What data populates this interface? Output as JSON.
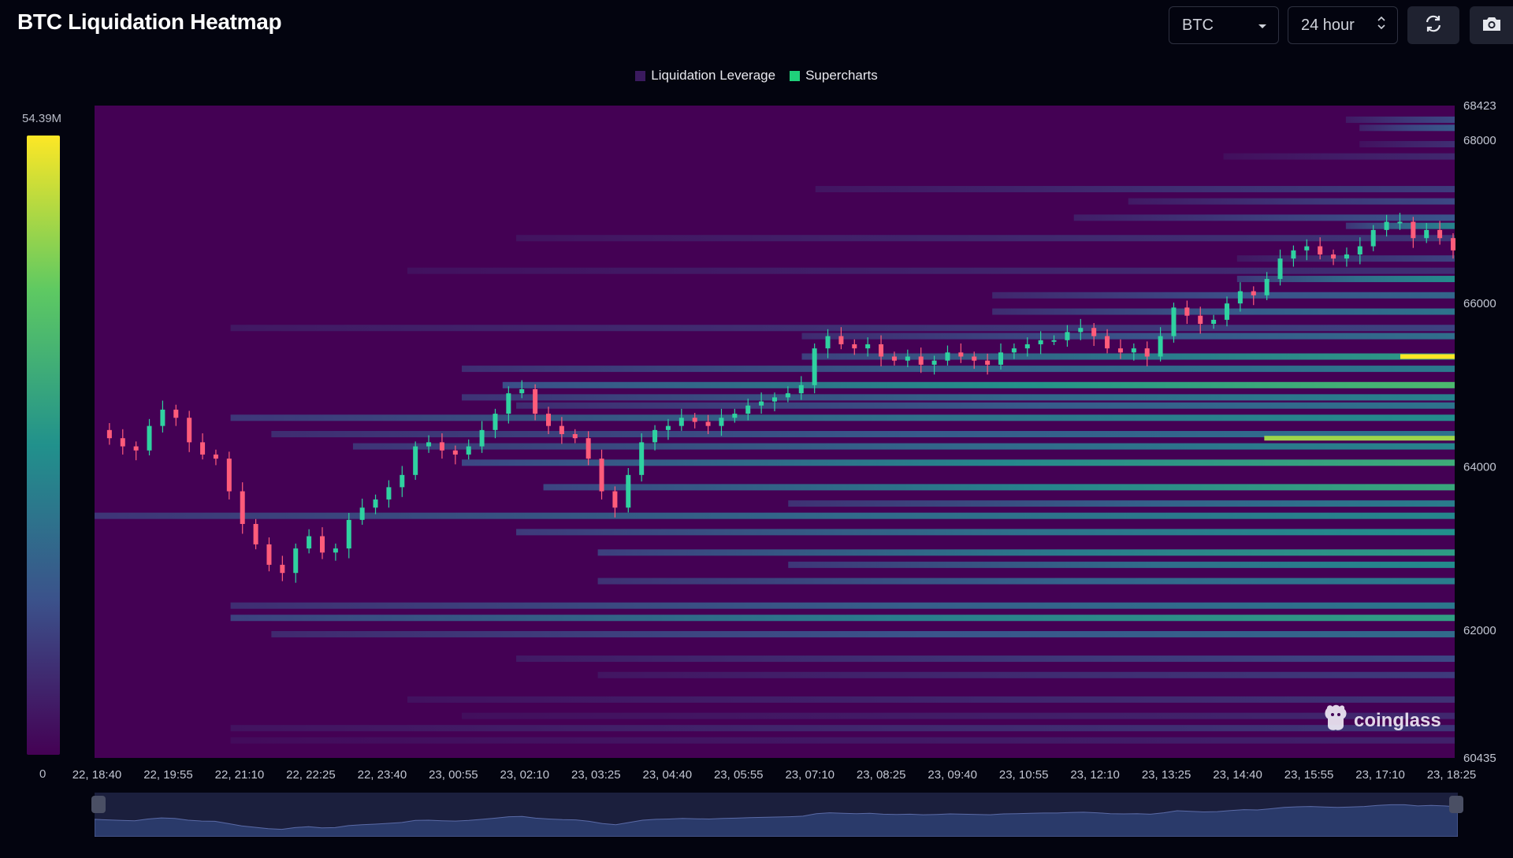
{
  "header": {
    "title": "BTC Liquidation Heatmap"
  },
  "controls": {
    "coin_label": "BTC",
    "range_label": "24 hour",
    "refresh_icon": "refresh-icon",
    "camera_icon": "camera-icon"
  },
  "legend": [
    {
      "label": "Liquidation Leverage",
      "color": "#3a1a5e"
    },
    {
      "label": "Supercharts",
      "color": "#1fd17a"
    }
  ],
  "colorbar": {
    "max_label": "54.39M",
    "min_label": "0"
  },
  "watermark": {
    "text": "coinglass"
  },
  "chart_data": {
    "type": "heatmap",
    "price_range": [
      60435,
      68423
    ],
    "y_ticks": [
      68423,
      68000,
      66000,
      64000,
      62000,
      60435
    ],
    "x_ticks": [
      "22, 18:40",
      "22, 19:55",
      "22, 21:10",
      "22, 22:25",
      "22, 23:40",
      "23, 00:55",
      "23, 02:10",
      "23, 03:25",
      "23, 04:40",
      "23, 05:55",
      "23, 07:10",
      "23, 08:25",
      "23, 09:40",
      "23, 10:55",
      "23, 12:10",
      "23, 13:25",
      "23, 14:40",
      "23, 15:55",
      "23, 17:10",
      "23, 18:25"
    ],
    "price_series": [
      64450,
      64350,
      64250,
      64200,
      64500,
      64700,
      64600,
      64300,
      64150,
      64100,
      63700,
      63300,
      63050,
      62800,
      62700,
      63000,
      63150,
      62950,
      63000,
      63350,
      63500,
      63600,
      63750,
      63900,
      64250,
      64300,
      64200,
      64150,
      64250,
      64450,
      64650,
      64900,
      64950,
      64650,
      64500,
      64400,
      64350,
      64100,
      63700,
      63500,
      63900,
      64300,
      64450,
      64500,
      64600,
      64550,
      64500,
      64600,
      64650,
      64750,
      64800,
      64850,
      64900,
      65000,
      65450,
      65600,
      65500,
      65450,
      65500,
      65350,
      65300,
      65350,
      65250,
      65300,
      65400,
      65350,
      65300,
      65250,
      65400,
      65450,
      65500,
      65550,
      65550,
      65650,
      65700,
      65600,
      65450,
      65400,
      65450,
      65350,
      65600,
      65950,
      65850,
      65750,
      65800,
      66000,
      66150,
      66100,
      66300,
      66550,
      66650,
      66700,
      66600,
      66550,
      66600,
      66700,
      66900,
      67000,
      67000,
      66800,
      66900,
      66800,
      66650
    ],
    "liquidation_bands": [
      {
        "price": 68250,
        "start": 0.92,
        "intensity": 0.22
      },
      {
        "price": 68150,
        "start": 0.93,
        "intensity": 0.28
      },
      {
        "price": 67950,
        "start": 0.93,
        "intensity": 0.14
      },
      {
        "price": 67800,
        "start": 0.83,
        "intensity": 0.12
      },
      {
        "price": 67400,
        "start": 0.53,
        "intensity": 0.18
      },
      {
        "price": 67250,
        "start": 0.76,
        "intensity": 0.22
      },
      {
        "price": 67050,
        "start": 0.72,
        "intensity": 0.26
      },
      {
        "price": 66950,
        "start": 0.92,
        "intensity": 0.45
      },
      {
        "price": 66800,
        "start": 0.31,
        "intensity": 0.16
      },
      {
        "price": 66550,
        "start": 0.84,
        "intensity": 0.2
      },
      {
        "price": 66400,
        "start": 0.23,
        "intensity": 0.14
      },
      {
        "price": 66300,
        "start": 0.84,
        "intensity": 0.48
      },
      {
        "price": 66100,
        "start": 0.66,
        "intensity": 0.33
      },
      {
        "price": 65900,
        "start": 0.66,
        "intensity": 0.38
      },
      {
        "price": 65700,
        "start": 0.1,
        "intensity": 0.2
      },
      {
        "price": 65600,
        "start": 0.52,
        "intensity": 0.36
      },
      {
        "price": 65350,
        "start": 0.52,
        "intensity": 0.55
      },
      {
        "price": 65200,
        "start": 0.27,
        "intensity": 0.4
      },
      {
        "price": 65000,
        "start": 0.3,
        "intensity": 0.68
      },
      {
        "price": 64850,
        "start": 0.27,
        "intensity": 0.44
      },
      {
        "price": 64750,
        "start": 0.31,
        "intensity": 0.38
      },
      {
        "price": 64600,
        "start": 0.1,
        "intensity": 0.48
      },
      {
        "price": 64400,
        "start": 0.13,
        "intensity": 0.38
      },
      {
        "price": 64250,
        "start": 0.19,
        "intensity": 0.45
      },
      {
        "price": 64050,
        "start": 0.27,
        "intensity": 0.62
      },
      {
        "price": 63750,
        "start": 0.33,
        "intensity": 0.6
      },
      {
        "price": 63550,
        "start": 0.51,
        "intensity": 0.42
      },
      {
        "price": 63400,
        "start": 0.0,
        "intensity": 0.46
      },
      {
        "price": 63200,
        "start": 0.31,
        "intensity": 0.5
      },
      {
        "price": 62950,
        "start": 0.37,
        "intensity": 0.55
      },
      {
        "price": 62800,
        "start": 0.51,
        "intensity": 0.48
      },
      {
        "price": 62600,
        "start": 0.37,
        "intensity": 0.42
      },
      {
        "price": 62300,
        "start": 0.1,
        "intensity": 0.4
      },
      {
        "price": 62150,
        "start": 0.1,
        "intensity": 0.56
      },
      {
        "price": 61950,
        "start": 0.13,
        "intensity": 0.35
      },
      {
        "price": 61650,
        "start": 0.31,
        "intensity": 0.22
      },
      {
        "price": 61450,
        "start": 0.37,
        "intensity": 0.18
      },
      {
        "price": 61150,
        "start": 0.23,
        "intensity": 0.15
      },
      {
        "price": 60950,
        "start": 0.27,
        "intensity": 0.12
      },
      {
        "price": 60800,
        "start": 0.1,
        "intensity": 0.16
      },
      {
        "price": 60650,
        "start": 0.1,
        "intensity": 0.1
      }
    ],
    "hotspots": [
      {
        "price": 65350,
        "start": 0.96,
        "end": 1.0,
        "intensity": 1.0
      },
      {
        "price": 64350,
        "start": 0.86,
        "end": 1.0,
        "intensity": 0.85
      }
    ]
  }
}
